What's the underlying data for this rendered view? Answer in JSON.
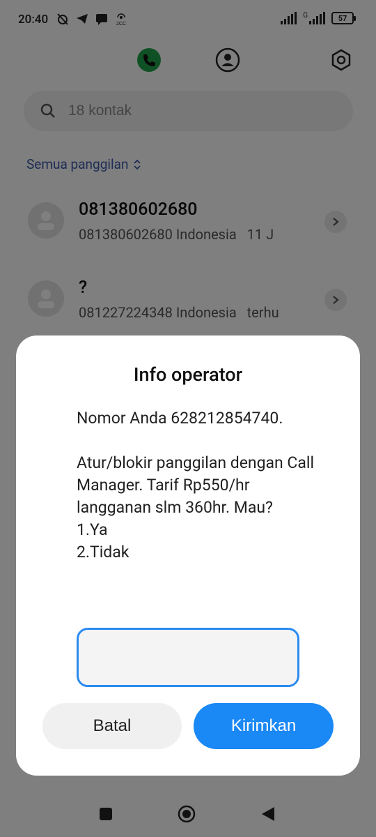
{
  "status_bar": {
    "time": "20:40",
    "network_label": "G",
    "battery": "57"
  },
  "search": {
    "placeholder": "18 kontak"
  },
  "filter": {
    "label": "Semua panggilan"
  },
  "calls": [
    {
      "name": "081380602680",
      "number": "081380602680",
      "location": "Indonesia",
      "extra": "11 J"
    },
    {
      "name": "?",
      "number": "081227224348",
      "location": "Indonesia",
      "extra": "terhu"
    }
  ],
  "dialog": {
    "title": "Info operator",
    "message": "Nomor Anda 628212854740.\n\nAtur/blokir panggilan dengan Call Manager. Tarif Rp550/hr langganan slm 360hr. Mau?\n1.Ya\n2.Tidak",
    "input_value": "",
    "cancel_label": "Batal",
    "send_label": "Kirimkan"
  },
  "colors": {
    "accent_blue": "#1a88f5",
    "phone_green": "#1ea34a",
    "filter_blue": "#3d5aa8"
  }
}
